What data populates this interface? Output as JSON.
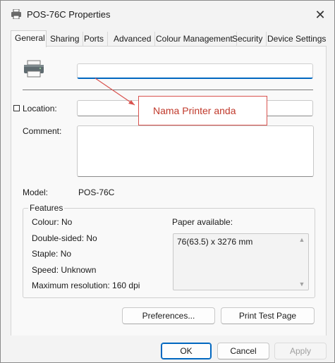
{
  "window": {
    "title": "POS-76C Properties",
    "close_glyph": "✕"
  },
  "tabs": [
    {
      "label": "General"
    },
    {
      "label": "Sharing"
    },
    {
      "label": "Ports"
    },
    {
      "label": "Advanced"
    },
    {
      "label": "Colour Management"
    },
    {
      "label": "Security"
    },
    {
      "label": "Device Settings"
    }
  ],
  "general": {
    "printer_name_value": "",
    "location_label": "Location:",
    "location_value": "",
    "comment_label": "Comment:",
    "comment_value": "",
    "model_label": "Model:",
    "model_value": "POS-76C"
  },
  "annotation": {
    "text": "Nama Printer anda",
    "color": "#c0392b"
  },
  "features": {
    "legend": "Features",
    "colour": "Colour: No",
    "double_sided": "Double-sided: No",
    "staple": "Staple: No",
    "speed": "Speed: Unknown",
    "max_resolution": "Maximum resolution: 160 dpi",
    "paper_label": "Paper available:",
    "paper_items": [
      "76(63.5) x 3276 mm"
    ]
  },
  "buttons": {
    "preferences": "Preferences...",
    "print_test": "Print Test Page",
    "ok": "OK",
    "cancel": "Cancel",
    "apply": "Apply"
  },
  "colors": {
    "accent": "#0067c0",
    "window_bg": "#f3f3f3"
  }
}
